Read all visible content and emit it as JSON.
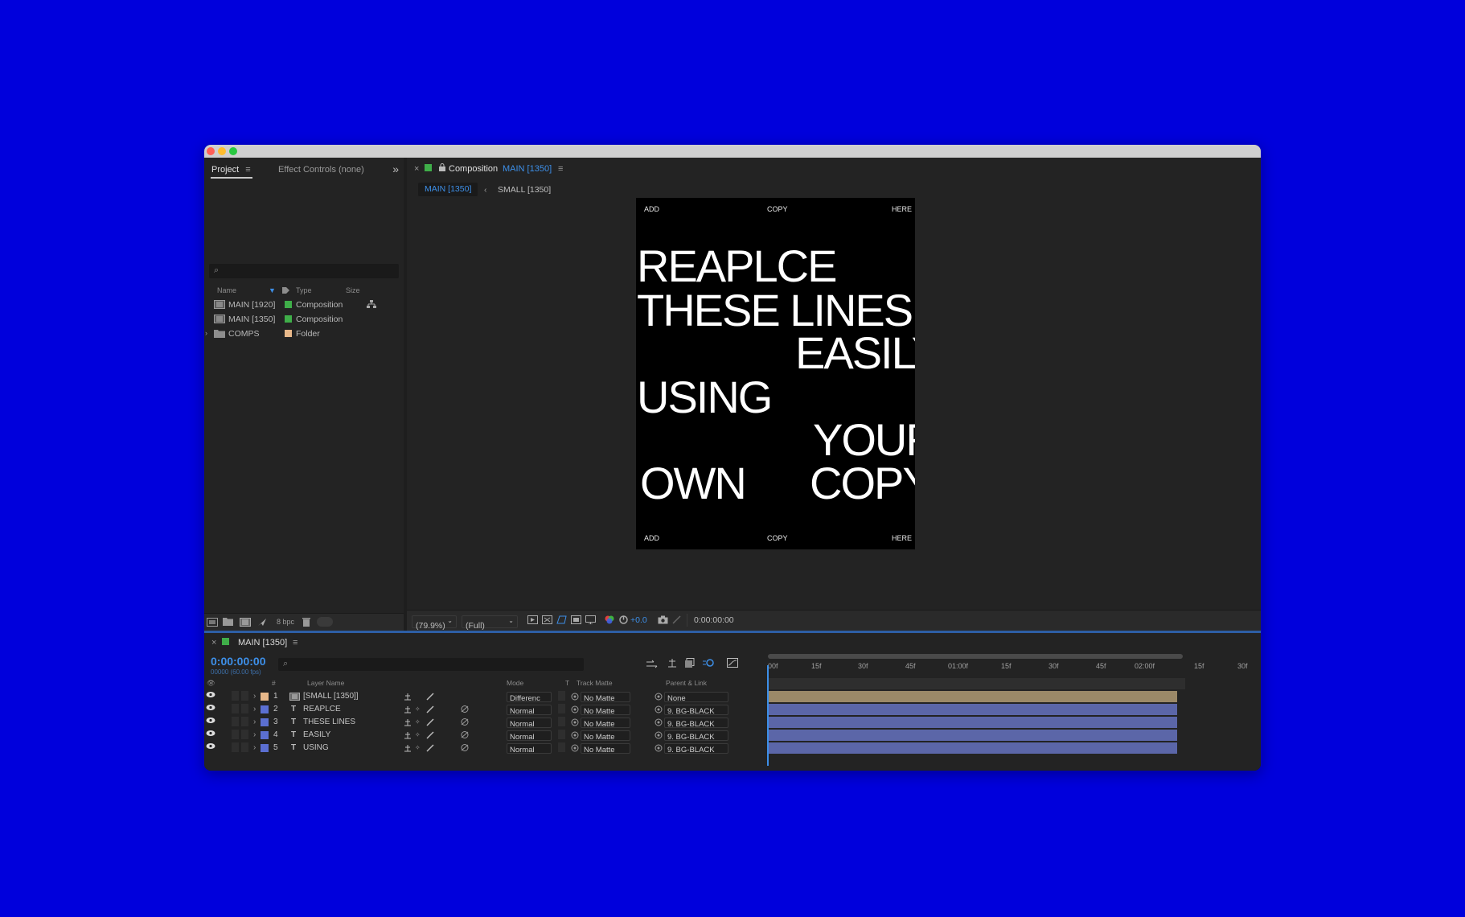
{
  "project_panel": {
    "tab_active": "Project",
    "tab_inactive": "Effect Controls (none)",
    "menu_glyph": "≡",
    "overflow_glyph": "»",
    "search_icon": "⌕",
    "columns": {
      "name": "Name",
      "type": "Type",
      "size": "Size"
    },
    "items": [
      {
        "name": "MAIN [1920]",
        "type": "Composition",
        "color": "#3fae49"
      },
      {
        "name": "MAIN [1350]",
        "type": "Composition",
        "color": "#3fae49"
      },
      {
        "name": "COMPS",
        "type": "Folder",
        "color": "#e8b88a"
      }
    ],
    "bpc": "8 bpc"
  },
  "comp_panel": {
    "close": "×",
    "title_prefix": "Composition",
    "title_name": "MAIN [1350]",
    "subtabs": [
      "MAIN [1350]",
      "SMALL [1350]"
    ],
    "canvas_captions": {
      "top": [
        "ADD",
        "COPY",
        "HERE"
      ],
      "bottom": [
        "ADD",
        "COPY",
        "HERE"
      ]
    },
    "lines": [
      "REAPLCE",
      "THESE LINES",
      "EASILY",
      "USING",
      "YOUR",
      "OWN",
      "COPY"
    ],
    "zoom": "(79.9%)",
    "resolution": "(Full)",
    "exposure": "+0.0",
    "timecode": "0:00:00:00"
  },
  "timeline": {
    "close": "×",
    "comp_name": "MAIN [1350]",
    "timecode": "0:00:00:00",
    "fps": "00000 (60.00 fps)",
    "columns": {
      "num": "#",
      "layer_name": "Layer Name",
      "mode": "Mode",
      "t": "T",
      "track_matte": "Track Matte",
      "parent": "Parent & Link"
    },
    "ruler": [
      "00f",
      "15f",
      "30f",
      "45f",
      "01:00f",
      "15f",
      "30f",
      "45f",
      "02:00f",
      "15f",
      "30f"
    ],
    "layers": [
      {
        "num": "1",
        "name": "[SMALL [1350]]",
        "mode": "Differenc",
        "matte": "No Matte",
        "parent": "None",
        "color": "#e8b88a",
        "bar": "#9b8968"
      },
      {
        "num": "2",
        "name": "REAPLCE",
        "mode": "Normal",
        "matte": "No Matte",
        "parent": "9. BG-BLACK",
        "color": "#5b6fd1",
        "bar": "#5b66a8"
      },
      {
        "num": "3",
        "name": "THESE   LINES",
        "mode": "Normal",
        "matte": "No Matte",
        "parent": "9. BG-BLACK",
        "color": "#5b6fd1",
        "bar": "#5b66a8"
      },
      {
        "num": "4",
        "name": "EASILY",
        "mode": "Normal",
        "matte": "No Matte",
        "parent": "9. BG-BLACK",
        "color": "#5b6fd1",
        "bar": "#5b66a8"
      },
      {
        "num": "5",
        "name": "USING",
        "mode": "Normal",
        "matte": "No Matte",
        "parent": "9. BG-BLACK",
        "color": "#5b6fd1",
        "bar": "#5b66a8"
      }
    ]
  },
  "colors": {
    "background": "#0000DC",
    "accent": "#3d8fe8"
  }
}
